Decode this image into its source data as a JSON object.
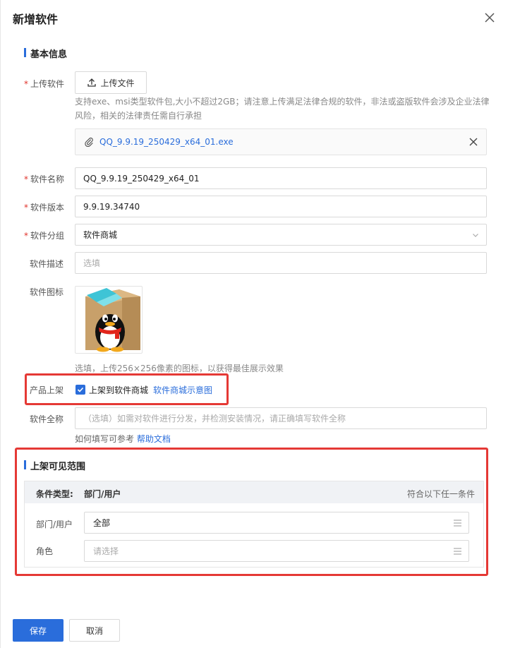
{
  "dialog": {
    "title": "新增软件"
  },
  "basic_section": {
    "title": "基本信息"
  },
  "upload": {
    "label": "上传软件",
    "button_label": "上传文件",
    "hint_line1": "支持exe、msi类型软件包,大小不超过2GB；请注意上传满足法律合规的软件，非法或盗版软件会涉及企业法律",
    "hint_line2": "风险，相关的法律责任需自行承担",
    "file_name": "QQ_9.9.19_250429_x64_01.exe"
  },
  "fields": {
    "name_label": "软件名称",
    "name_value": "QQ_9.9.19_250429_x64_01",
    "version_label": "软件版本",
    "version_value": "9.9.19.34740",
    "group_label": "软件分组",
    "group_value": "软件商城",
    "desc_label": "软件描述",
    "desc_placeholder": "选填",
    "icon_label": "软件图标",
    "icon_hint": "选填，上传256×256像素的图标，以获得最佳展示效果",
    "publish_label": "产品上架",
    "publish_checkbox_label": "上架到软件商城",
    "publish_checked": true,
    "publish_link": "软件商城示意图",
    "fullname_label": "软件全称",
    "fullname_placeholder": "（选填）如需对软件进行分发，并检测安装情况，请正确填写软件全称",
    "fullname_help_text": "如何填写可参考",
    "fullname_help_link": "帮助文档"
  },
  "visibility_section": {
    "title": "上架可见范围",
    "condition_type_label": "条件类型:",
    "condition_type_value": "部门/用户",
    "match_rule": "符合以下任一条件",
    "dept_label": "部门/用户",
    "dept_value": "全部",
    "role_label": "角色",
    "role_placeholder": "请选择"
  },
  "footer": {
    "save_label": "保存",
    "cancel_label": "取消"
  },
  "colors": {
    "primary": "#2a6ddb",
    "required": "#e0342c",
    "highlight_box": "#e53935"
  },
  "icons": {
    "close": "close-icon",
    "upload": "upload-icon",
    "attachment": "paperclip-icon",
    "remove": "close-icon",
    "dropdown": "chevron-down-icon",
    "list": "list-icon",
    "app": "qq-penguin-icon"
  }
}
